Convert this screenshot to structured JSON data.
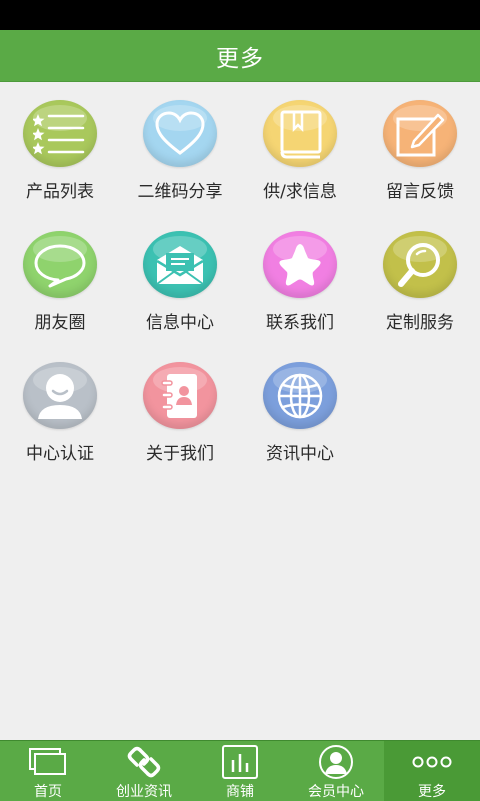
{
  "header": {
    "title": "更多"
  },
  "grid": {
    "items": [
      {
        "label": "产品列表",
        "icon": "list-icon",
        "color": "#a9c85c"
      },
      {
        "label": "二维码分享",
        "icon": "heart-icon",
        "color": "#a4d6f0"
      },
      {
        "label": "供/求信息",
        "icon": "book-icon",
        "color": "#f5d573"
      },
      {
        "label": "留言反馈",
        "icon": "edit-icon",
        "color": "#f6b377"
      },
      {
        "label": "朋友圈",
        "icon": "chat-bubble-icon",
        "color": "#8fd36d"
      },
      {
        "label": "信息中心",
        "icon": "envelope-icon",
        "color": "#3cc1b2"
      },
      {
        "label": "联系我们",
        "icon": "star-icon",
        "color": "#f17fe2"
      },
      {
        "label": "定制服务",
        "icon": "magnifier-icon",
        "color": "#c2c04a"
      },
      {
        "label": "中心认证",
        "icon": "user-icon",
        "color": "#b9c0c8"
      },
      {
        "label": "关于我们",
        "icon": "contact-book-icon",
        "color": "#f2949e"
      },
      {
        "label": "资讯中心",
        "icon": "globe-icon",
        "color": "#7c9fdc"
      }
    ]
  },
  "tabbar": {
    "items": [
      {
        "label": "首页",
        "icon": "home-windows-icon"
      },
      {
        "label": "创业资讯",
        "icon": "link-icon"
      },
      {
        "label": "商铺",
        "icon": "bar-chart-icon"
      },
      {
        "label": "会员中心",
        "icon": "member-icon"
      },
      {
        "label": "更多",
        "icon": "more-dots-icon",
        "active": true
      }
    ]
  },
  "colors": {
    "accent": "#5aaa46",
    "background": "#efefef",
    "status_bar": "#000000"
  }
}
